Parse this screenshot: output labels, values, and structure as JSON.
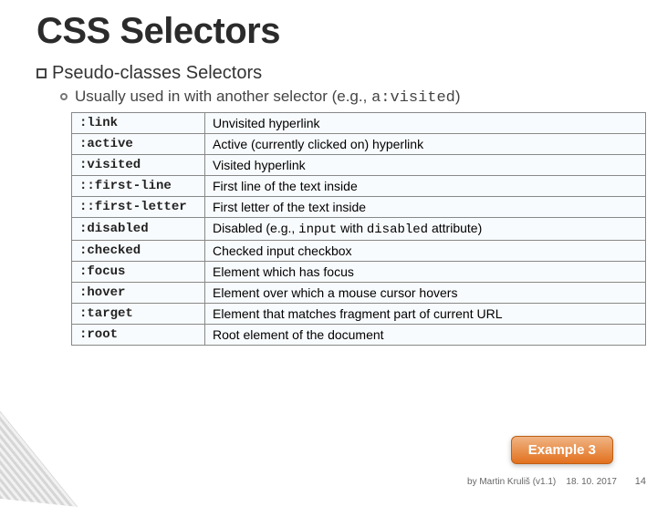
{
  "title": "CSS Selectors",
  "subhead_prefix": "Pseudo-classes ",
  "subhead_rest": "Selectors",
  "subline_prefix": "Usually used in with another selector (e.g., ",
  "subline_code": "a:visited",
  "subline_suffix": ")",
  "rows": [
    {
      "sel": ":link",
      "desc_plain": "Unvisited hyperlink"
    },
    {
      "sel": ":active",
      "desc_plain": "Active (currently clicked on) hyperlink"
    },
    {
      "sel": ":visited",
      "desc_plain": "Visited hyperlink"
    },
    {
      "sel": "::first-line",
      "desc_plain": "First line of the text inside"
    },
    {
      "sel": "::first-letter",
      "desc_plain": "First letter of the text inside"
    },
    {
      "sel": ":disabled",
      "desc_pre": "Disabled (e.g., ",
      "code1": "input",
      "desc_mid": " with ",
      "code2": "disabled",
      "desc_post": " attribute)"
    },
    {
      "sel": ":checked",
      "desc_plain": "Checked input checkbox"
    },
    {
      "sel": ":focus",
      "desc_plain": "Element which has focus"
    },
    {
      "sel": ":hover",
      "desc_plain": "Element over which a mouse cursor hovers"
    },
    {
      "sel": ":target",
      "desc_plain": "Element that matches fragment part of current URL"
    },
    {
      "sel": ":root",
      "desc_plain": "Root element of the document"
    }
  ],
  "badge": "Example 3",
  "footer_author": "by Martin Kruliš (v1.1)",
  "footer_date": "18. 10. 2017",
  "pagenum": "14"
}
